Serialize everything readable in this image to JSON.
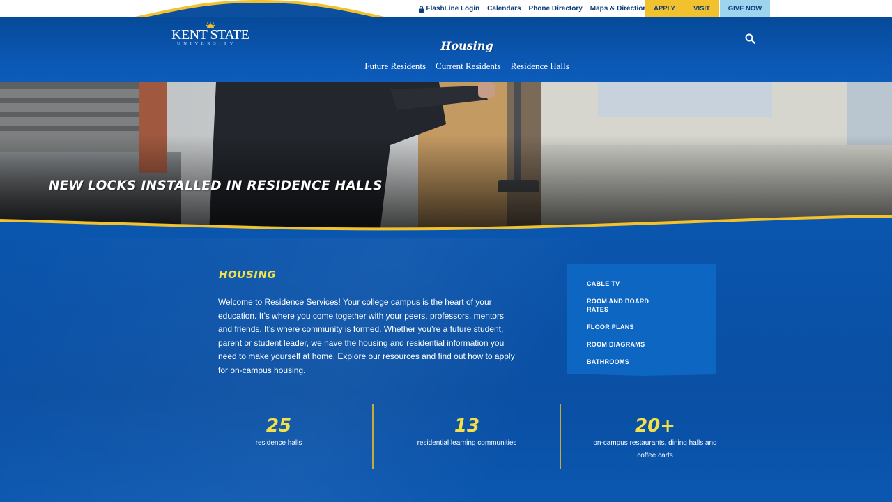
{
  "utility": {
    "links": [
      {
        "label": "FlashLine Login",
        "icon": "lock-icon"
      },
      {
        "label": "Calendars"
      },
      {
        "label": "Phone Directory"
      },
      {
        "label": "Maps & Directions"
      }
    ],
    "cta": {
      "apply": "APPLY",
      "visit": "VISIT",
      "give": "GIVE NOW"
    }
  },
  "header": {
    "logo_main": "KENT STATE",
    "logo_sub": "UNIVERSITY",
    "site_title": "Housing",
    "search_icon": "search-icon",
    "nav": [
      "Future Residents",
      "Current Residents",
      "Residence Halls"
    ]
  },
  "hero": {
    "caption": "NEW LOCKS INSTALLED IN RESIDENCE HALLS"
  },
  "main": {
    "heading": "HOUSING",
    "intro": "Welcome to Residence Services! Your college campus is the heart of your education. It’s where you come together with your peers, professors, mentors and friends. It’s where community is formed. Whether you’re a future student, parent or student leader, we have the housing and residential information you need to make yourself at home. Explore our resources and find out how to apply for on-campus housing.",
    "side_menu": [
      "CABLE TV",
      "ROOM AND BOARD RATES",
      "FLOOR PLANS",
      "ROOM DIAGRAMS",
      "BATHROOMS"
    ],
    "stats": [
      {
        "value": "25",
        "label": "residence halls"
      },
      {
        "value": "13",
        "label": "residential learning communities"
      },
      {
        "value": "20+",
        "label": "on-campus restaurants, dining halls and coffee carts"
      }
    ]
  },
  "colors": {
    "brand_blue": "#0b4f9e",
    "accent_gold": "#f2c12e",
    "heading_yellow": "#f1e04a",
    "give_button": "#9fd4ef"
  }
}
